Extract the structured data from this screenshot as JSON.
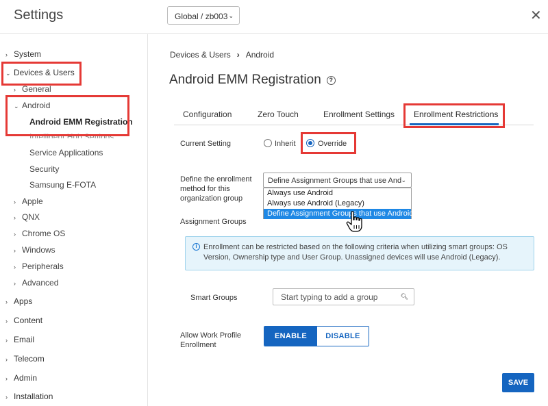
{
  "header": {
    "title": "Settings",
    "org_group": "Global / zb003"
  },
  "sidebar": {
    "system": "System",
    "devices_users": "Devices & Users",
    "general": "General",
    "android": "Android",
    "android_emm": "Android EMM Registration",
    "intelligent_hub": "Intelligent Hub Settings",
    "service_apps": "Service Applications",
    "security": "Security",
    "samsung_efota": "Samsung E-FOTA",
    "apple": "Apple",
    "qnx": "QNX",
    "chrome_os": "Chrome OS",
    "windows": "Windows",
    "peripherals": "Peripherals",
    "advanced": "Advanced",
    "apps": "Apps",
    "content": "Content",
    "email": "Email",
    "telecom": "Telecom",
    "admin": "Admin",
    "installation": "Installation"
  },
  "breadcrumb": {
    "root": "Devices & Users",
    "current": "Android"
  },
  "page_title": "Android EMM Registration",
  "tabs": {
    "configuration": "Configuration",
    "zero_touch": "Zero Touch",
    "enrollment_settings": "Enrollment Settings",
    "enrollment_restrictions": "Enrollment Restrictions"
  },
  "form": {
    "current_setting_label": "Current Setting",
    "inherit": "Inherit",
    "override": "Override",
    "define_label_1": "Define the enrollment",
    "define_label_2": "method for this",
    "define_label_3": "organization group",
    "define_value": "Define Assignment Groups that use And",
    "options": [
      "Always use Android",
      "Always use Android (Legacy)",
      "Define Assignment Groups that use Android"
    ],
    "assignment_groups_label": "Assignment Groups",
    "info_text": "Enrollment can be restricted based on the following criteria when utilizing smart groups: OS Version, Ownership type and User Group. Unassigned devices will use Android (Legacy).",
    "smart_groups_label": "Smart Groups",
    "smart_groups_placeholder": "Start typing to add a group",
    "work_profile_label_1": "Allow Work Profile",
    "work_profile_label_2": "Enrollment",
    "enable": "ENABLE",
    "disable": "DISABLE",
    "save": "SAVE"
  },
  "colors": {
    "accent": "#1565c0",
    "highlight_box": "#e53935",
    "info_bg": "#e6f4fb"
  }
}
